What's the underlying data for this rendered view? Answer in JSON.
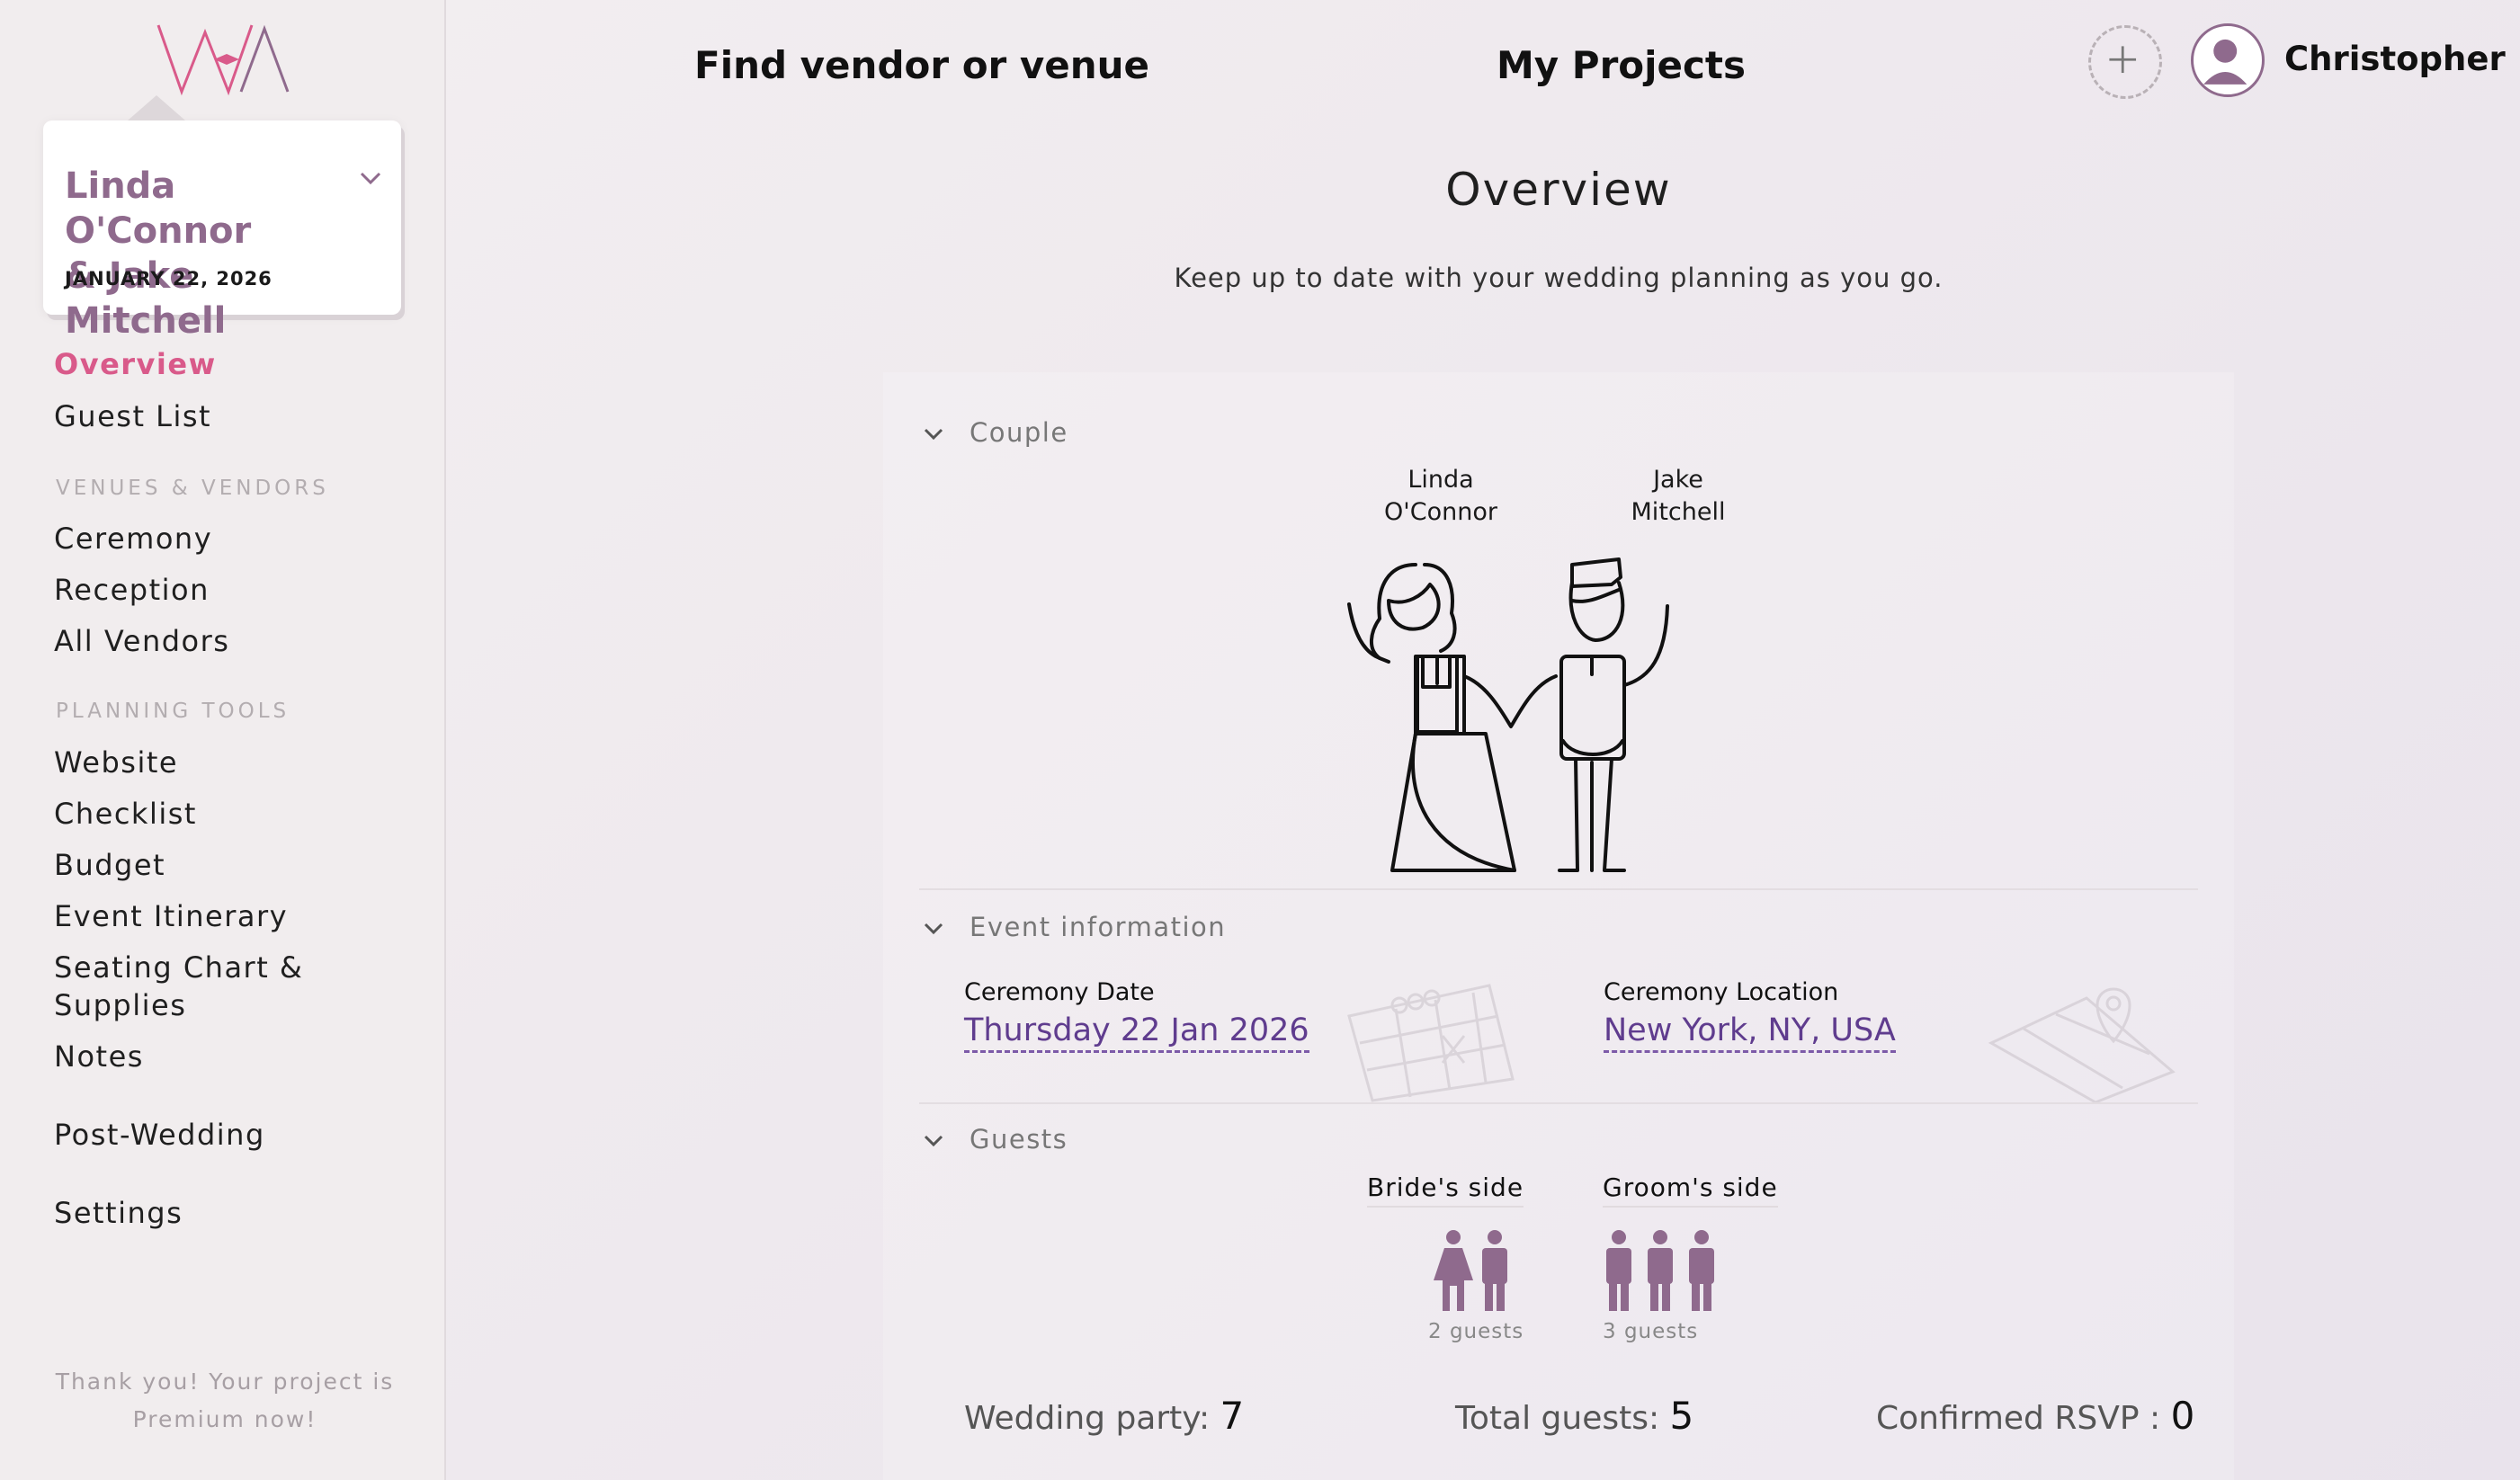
{
  "header": {
    "find_vendor": "Find vendor or venue",
    "my_projects": "My Projects",
    "user_name": "Christopher"
  },
  "project": {
    "names_line1": "Linda O'Connor",
    "names_line2": "& Jake Mitchell",
    "date": "JANUARY 22, 2026"
  },
  "sidebar": {
    "items": {
      "overview": "Overview",
      "guest_list": "Guest List",
      "ceremony": "Ceremony",
      "reception": "Reception",
      "all_vendors": "All Vendors",
      "website": "Website",
      "checklist": "Checklist",
      "budget": "Budget",
      "event_itinerary": "Event Itinerary",
      "seating_line1": "Seating Chart &",
      "seating_line2": "Supplies",
      "notes": "Notes",
      "post_wedding": "Post-Wedding",
      "settings": "Settings"
    },
    "sections": {
      "venues_vendors": "VENUES & VENDORS",
      "planning_tools": "PLANNING TOOLS"
    },
    "premium_line1": "Thank you! Your project is",
    "premium_line2": "Premium now!"
  },
  "main": {
    "title": "Overview",
    "subtitle": "Keep up to date with your wedding planning as you go."
  },
  "couple": {
    "heading": "Couple",
    "bride_first": "Linda",
    "bride_last": "O'Connor",
    "groom_first": "Jake",
    "groom_last": "Mitchell"
  },
  "event": {
    "heading": "Event information",
    "date_label": "Ceremony Date",
    "date_value": "Thursday 22 Jan 2026",
    "location_label": "Ceremony Location",
    "location_value": "New York, NY, USA"
  },
  "guests": {
    "heading": "Guests",
    "bride_side": "Bride's side",
    "groom_side": "Groom's side",
    "bride_count": "2 guests",
    "groom_count": "3 guests"
  },
  "stats": {
    "wedding_party_label": "Wedding party:",
    "wedding_party_value": "7",
    "total_guests_label": "Total guests:",
    "total_guests_value": "5",
    "confirmed_label": "Confirmed RSVP :",
    "confirmed_value": "0"
  },
  "colors": {
    "accent_pink": "#d95a8a",
    "brand_mauve": "#8f6a8d",
    "link_purple": "#5f3c8e"
  }
}
